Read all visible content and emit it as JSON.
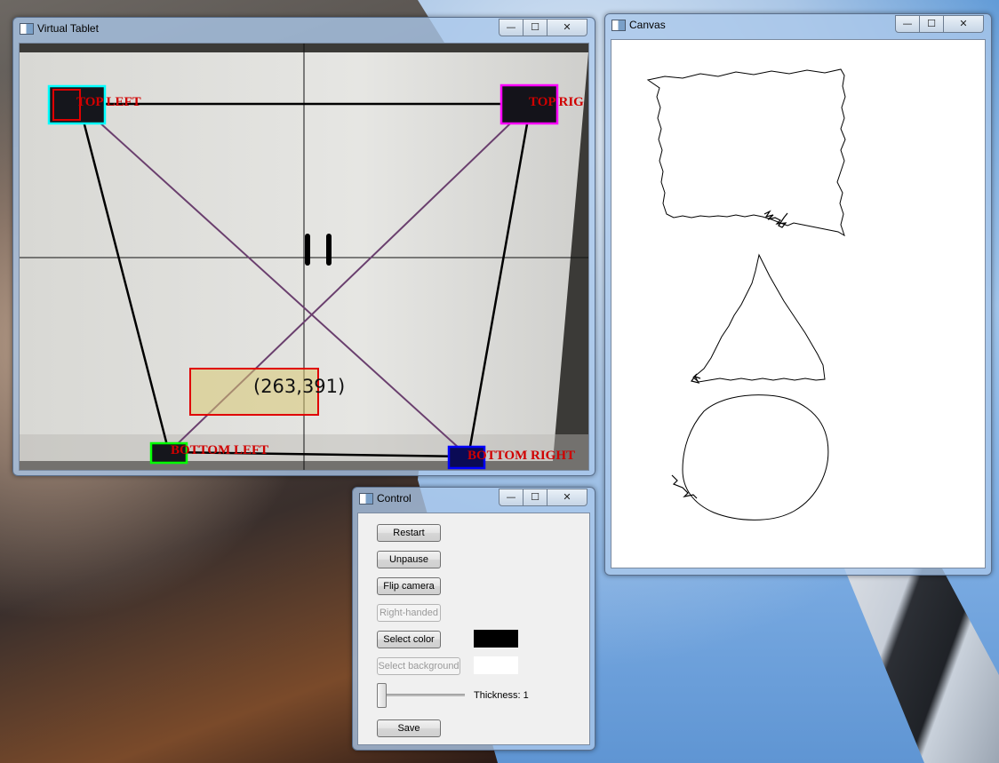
{
  "windows": {
    "virtual_tablet": {
      "title": "Virtual Tablet",
      "labels": {
        "top_left": "TOP LEFT",
        "top_right": "TOP RIG",
        "bottom_left": "BOTTOM LEFT",
        "bottom_right": "BOTTOM RIGHT"
      },
      "pointer_coordinate": "(263,391)"
    },
    "canvas": {
      "title": "Canvas"
    },
    "control": {
      "title": "Control",
      "buttons": {
        "restart": "Restart",
        "unpause": "Unpause",
        "flip_camera": "Flip camera",
        "right_handed": "Right-handed",
        "select_color": "Select color",
        "select_background": "Select background",
        "save": "Save"
      },
      "thickness_label": "Thickness: 1",
      "thickness_value": 1,
      "color_swatch": "#000000",
      "background_swatch": "#ffffff"
    }
  },
  "window_controls": {
    "minimize": "—",
    "maximize": "☐",
    "close": "✕"
  },
  "icons": [
    "app-window-icon",
    "minimize-icon",
    "maximize-icon",
    "close-icon",
    "pause-icon"
  ],
  "colors": {
    "label_red": "#d00000",
    "marker_cyan": "#00ffff",
    "marker_magenta": "#ff00ff",
    "marker_green": "#00ff00",
    "marker_blue": "#0000ff",
    "diagonal_purple": "#6a3f6e"
  }
}
